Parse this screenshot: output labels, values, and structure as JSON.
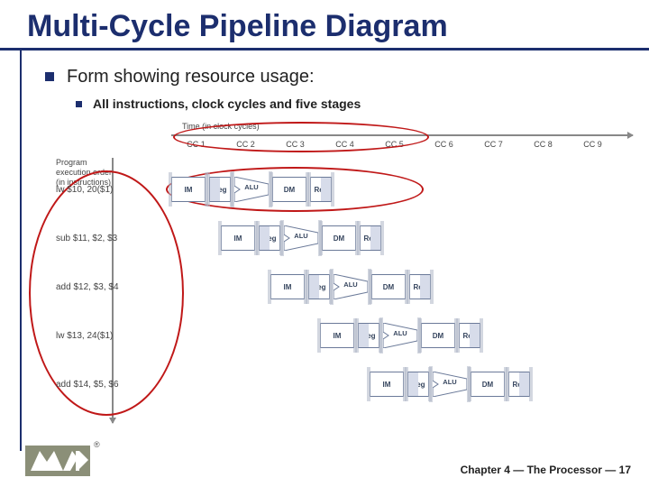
{
  "title": "Multi-Cycle Pipeline Diagram",
  "bullet1": "Form showing resource usage:",
  "bullet2": "All instructions, clock cycles and five stages",
  "timeLabel": "Time (in clock cycles)",
  "progLabel": "Program execution order (in instructions)",
  "cc": [
    "CC 1",
    "CC 2",
    "CC 3",
    "CC 4",
    "CC 5",
    "CC 6",
    "CC 7",
    "CC 8",
    "CC 9"
  ],
  "stages": {
    "im": "IM",
    "reg": "Reg",
    "alu": "ALU",
    "dm": "DM"
  },
  "instructions": [
    {
      "label": "lw $10, 20($1)",
      "start": 0
    },
    {
      "label": "sub $11, $2, $3",
      "start": 1
    },
    {
      "label": "add $12, $3, $4",
      "start": 2
    },
    {
      "label": "lw $13, 24($1)",
      "start": 3
    },
    {
      "label": "add $14, $5, $6",
      "start": 4
    }
  ],
  "footer": {
    "chapter": "Chapter 4",
    "section": "The Processor",
    "page": "17"
  }
}
